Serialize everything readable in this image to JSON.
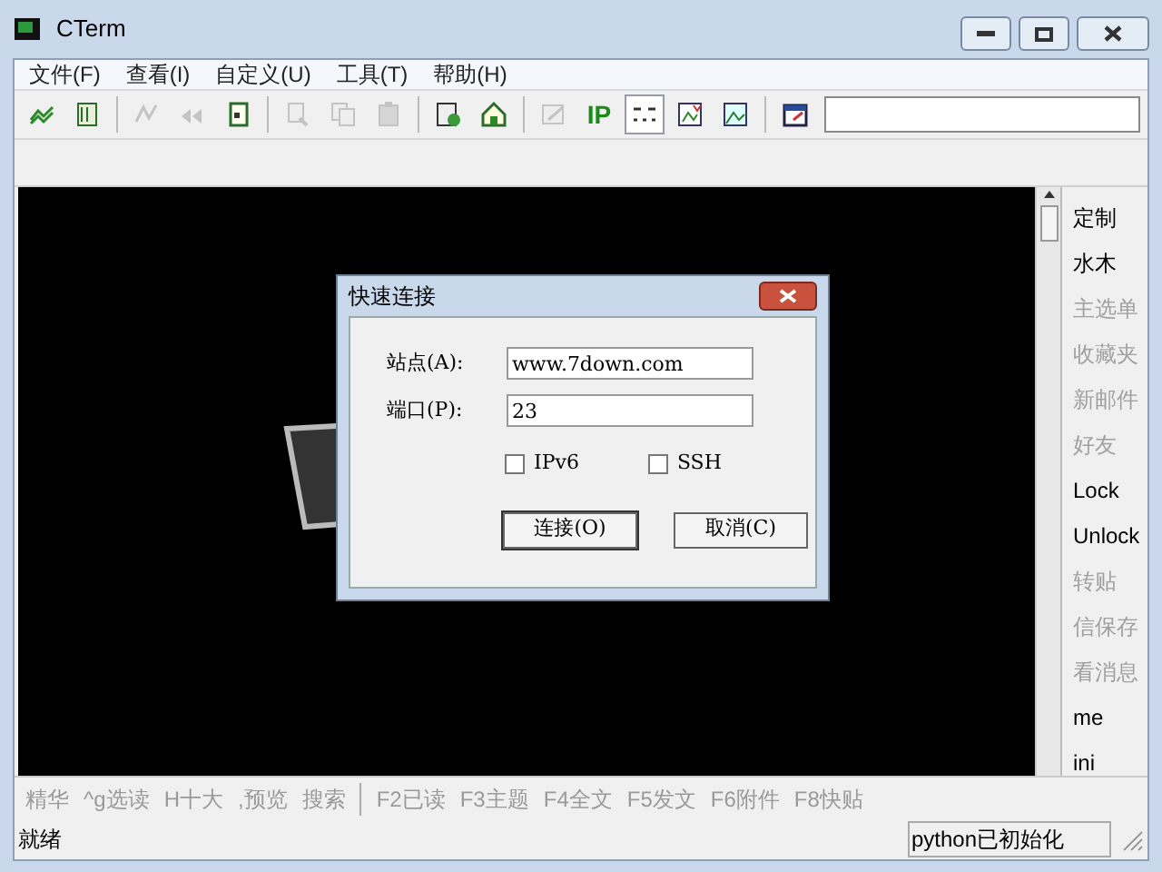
{
  "window": {
    "title": "CTerm"
  },
  "menu": [
    "文件(F)",
    "查看(I)",
    "自定义(U)",
    "工具(T)",
    "帮助(H)"
  ],
  "toolbar": [
    {
      "kind": "icon",
      "disabled": false
    },
    {
      "kind": "icon",
      "disabled": false
    },
    {
      "kind": "sep"
    },
    {
      "kind": "icon",
      "disabled": true
    },
    {
      "kind": "icon",
      "disabled": true
    },
    {
      "kind": "icon",
      "disabled": false
    },
    {
      "kind": "sep"
    },
    {
      "kind": "icon",
      "disabled": true
    },
    {
      "kind": "icon",
      "disabled": true
    },
    {
      "kind": "icon",
      "disabled": true
    },
    {
      "kind": "sep"
    },
    {
      "kind": "icon",
      "disabled": false
    },
    {
      "kind": "icon",
      "disabled": false
    },
    {
      "kind": "sep"
    },
    {
      "kind": "icon",
      "disabled": true
    },
    {
      "kind": "text",
      "label": "IP"
    },
    {
      "kind": "icon",
      "disabled": false,
      "selected": true
    },
    {
      "kind": "icon",
      "disabled": false
    },
    {
      "kind": "icon",
      "disabled": false
    },
    {
      "kind": "sep"
    },
    {
      "kind": "icon",
      "disabled": false
    }
  ],
  "sidebar": {
    "items": [
      {
        "label": "定制",
        "disabled": false
      },
      {
        "label": "水木",
        "disabled": false
      },
      {
        "label": "主选单",
        "disabled": true
      },
      {
        "label": "收藏夹",
        "disabled": true
      },
      {
        "label": "新邮件",
        "disabled": true
      },
      {
        "label": "好友",
        "disabled": true
      },
      {
        "label": "Lock",
        "disabled": false
      },
      {
        "label": "Unlock",
        "disabled": false
      },
      {
        "label": "转贴",
        "disabled": true
      },
      {
        "label": "信保存",
        "disabled": true
      },
      {
        "label": "看消息",
        "disabled": true
      },
      {
        "label": "me",
        "disabled": false
      },
      {
        "label": "ini",
        "disabled": false
      }
    ]
  },
  "quickbar": {
    "groups": [
      [
        "精华",
        "^g选读",
        "H十大",
        ",预览",
        "搜索"
      ],
      [
        "F2已读",
        "F3主题",
        "F4全文",
        "F5发文",
        "F6附件",
        "F8快贴"
      ]
    ]
  },
  "dialog": {
    "title": "快速连接",
    "fields": [
      {
        "label": "站点(A):",
        "value": "www.7down.com"
      },
      {
        "label": "端口(P):",
        "value": "23"
      }
    ],
    "checkboxes": [
      {
        "label": "IPv6",
        "checked": false
      },
      {
        "label": "SSH",
        "checked": false
      }
    ],
    "buttons": [
      "连接(O)",
      "取消(C)"
    ]
  },
  "status_bar": {
    "left": "就绪",
    "right": "python已初始化"
  }
}
